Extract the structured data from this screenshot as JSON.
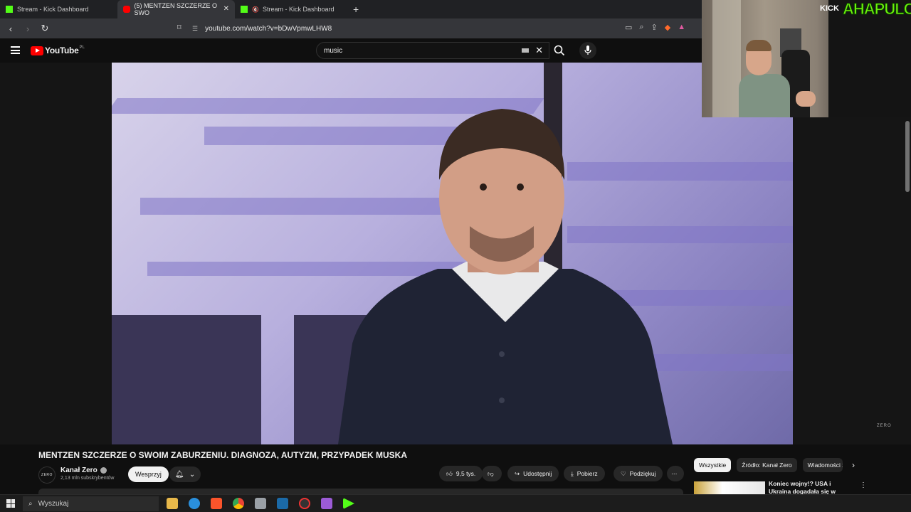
{
  "browser": {
    "tabs": [
      {
        "label": "Stream - Kick Dashboard",
        "favicon": "kick-icon",
        "active": false
      },
      {
        "label": "(5) MENTZEN SZCZERZE O SWO",
        "favicon": "youtube-icon",
        "active": true
      },
      {
        "label": "Stream - Kick Dashboard",
        "favicon": "kick-icon",
        "active": false
      }
    ],
    "url": "youtube.com/watch?v=bDwVpmwLHW8"
  },
  "youtube": {
    "logo_text": "YouTube",
    "country_code": "PL",
    "search_value": "music",
    "video_watermark": "ZERO",
    "title": "MENTZEN SZCZERZE O SWOIM ZABURZENIU. DIAGNOZA, AUTYZM, PRZYPADEK MUSKA",
    "channel": {
      "avatar_text": "ZERO",
      "name": "Kanał Zero",
      "subscribers": "2,13 mln subskrybentów"
    },
    "support_label": "Wesprzyj",
    "likes": "9,5 tys.",
    "share_label": "Udostępnij",
    "download_label": "Pobierz",
    "thanks_label": "Podziękuj",
    "chips": [
      "Wszystkie",
      "Źródło: Kanał Zero",
      "Wiadomości z"
    ],
    "recommendation": {
      "title": "Koniec wojny!? USA i Ukraina dogadała się w sprawie"
    }
  },
  "taskbar": {
    "search_placeholder": "Wyszukaj"
  },
  "overlay": {
    "kick_text": "KICK",
    "brand_text": "AHAPULCO"
  },
  "colors": {
    "youtube_red": "#ff0000",
    "kick_green": "#53fc18",
    "brand_green": "#6cf20c"
  }
}
